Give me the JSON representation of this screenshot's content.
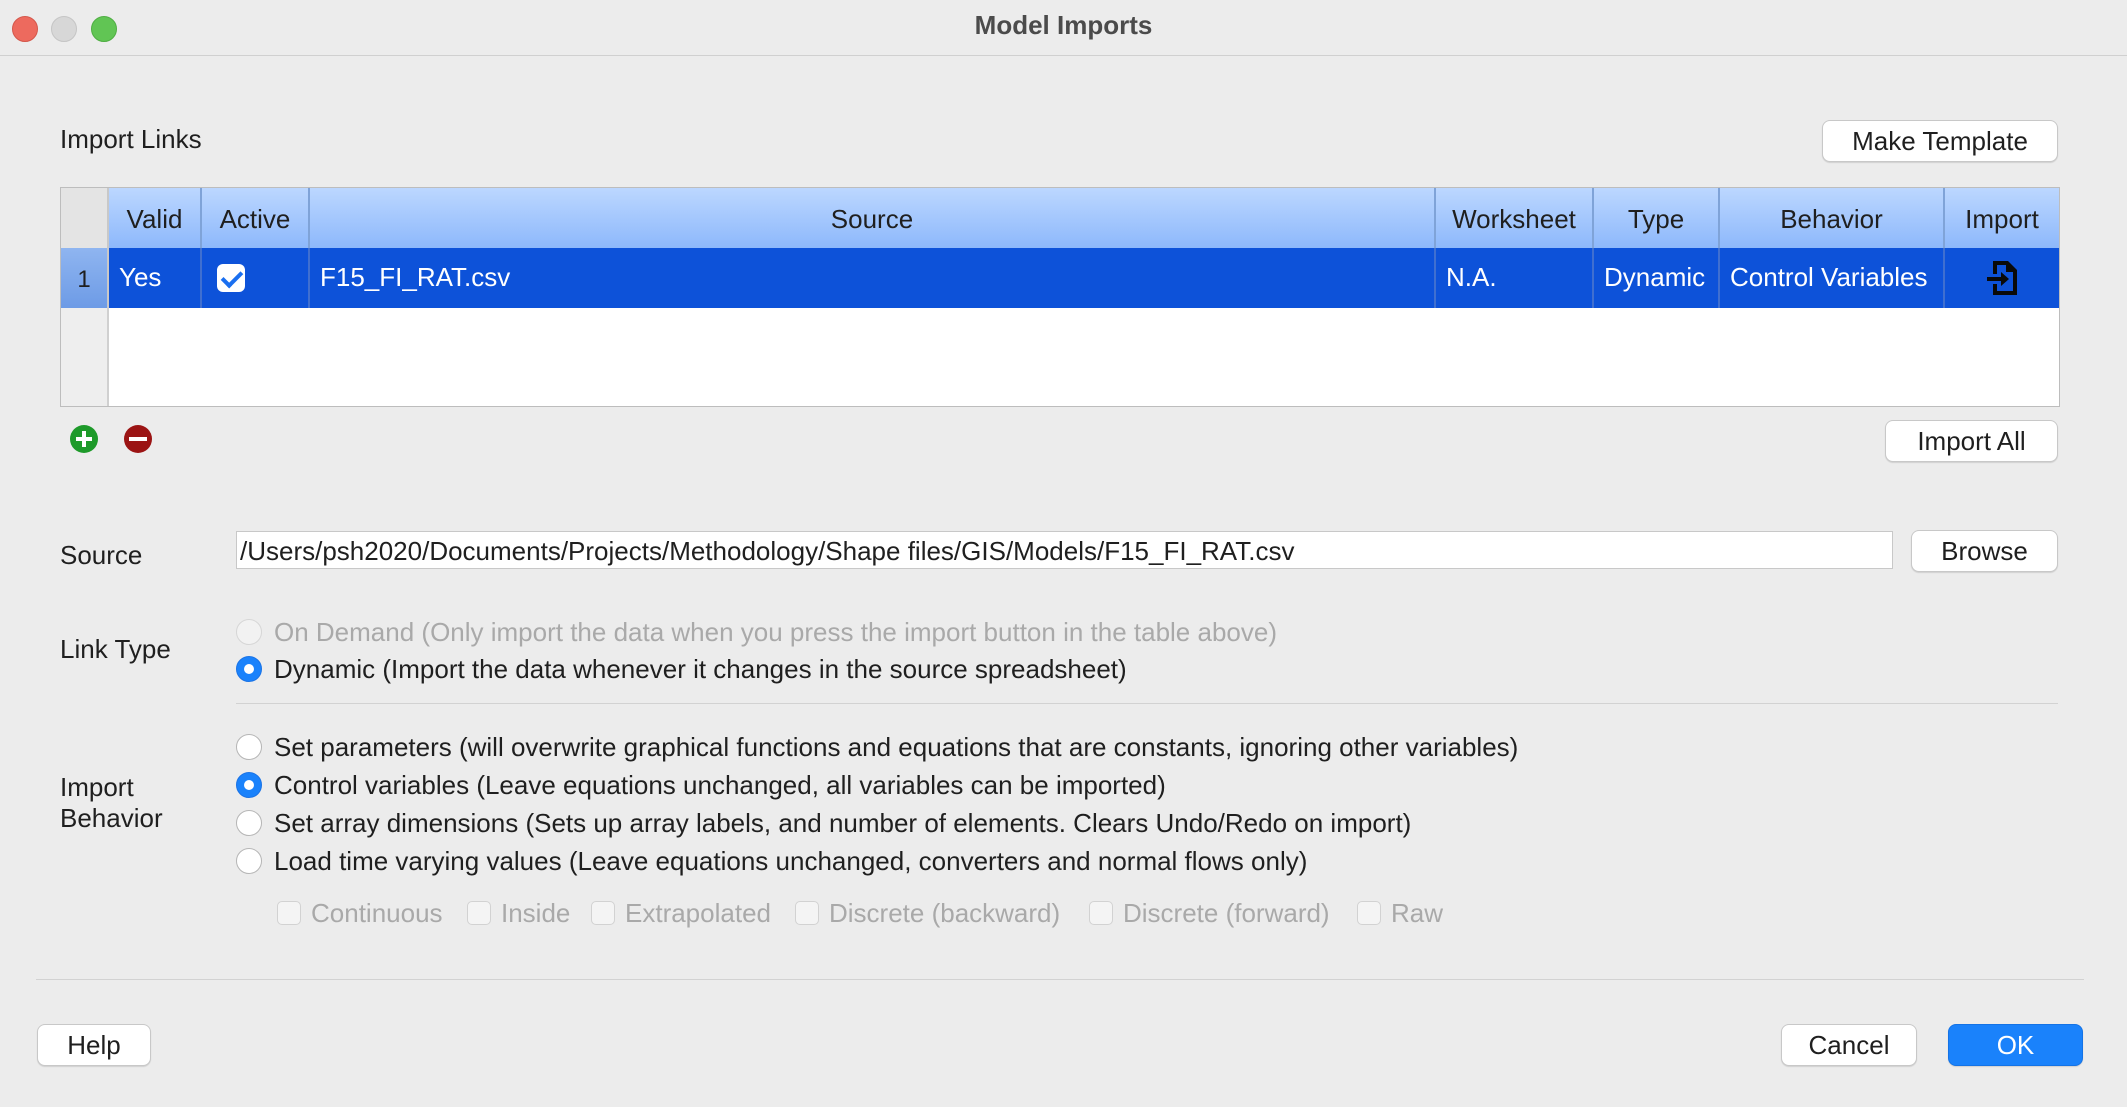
{
  "window": {
    "title": "Model Imports"
  },
  "import_links": {
    "label": "Import Links",
    "make_template_label": "Make Template",
    "import_all_label": "Import All",
    "columns": [
      "Valid",
      "Active",
      "Source",
      "Worksheet",
      "Type",
      "Behavior",
      "Import"
    ],
    "rows": [
      {
        "number": "1",
        "valid": "Yes",
        "active": true,
        "source": "F15_FI_RAT.csv",
        "worksheet": "N.A.",
        "type": "Dynamic",
        "behavior": "Control Variables",
        "import_icon": "import-file-icon"
      }
    ],
    "add_icon": "add-circle-icon",
    "remove_icon": "remove-circle-icon"
  },
  "source": {
    "label": "Source",
    "value": "/Users/psh2020/Documents/Projects/Methodology/Shape files/GIS/Models/F15_FI_RAT.csv",
    "browse_label": "Browse"
  },
  "link_type": {
    "label": "Link Type",
    "options": [
      {
        "label": "On Demand (Only import the data when you press the import button in the table above)",
        "selected": false,
        "enabled": false
      },
      {
        "label": "Dynamic (Import the data whenever it changes in the source spreadsheet)",
        "selected": true,
        "enabled": true
      }
    ]
  },
  "import_behavior": {
    "label_line1": "Import",
    "label_line2": "Behavior",
    "options": [
      {
        "label": "Set parameters (will overwrite graphical functions and equations that are constants, ignoring other variables)",
        "selected": false
      },
      {
        "label": "Control variables (Leave equations unchanged, all variables can be imported)",
        "selected": true
      },
      {
        "label": "Set array dimensions (Sets up array labels, and number of elements. Clears Undo/Redo on import)",
        "selected": false
      },
      {
        "label": "Load time varying values (Leave equations unchanged, converters and normal flows only)",
        "selected": false
      }
    ],
    "interpolation": [
      "Continuous",
      "Inside",
      "Extrapolated",
      "Discrete (backward)",
      "Discrete (forward)",
      "Raw"
    ]
  },
  "footer": {
    "help_label": "Help",
    "cancel_label": "Cancel",
    "ok_label": "OK"
  },
  "colors": {
    "selection": "#0d52d9",
    "accent": "#1a82fb",
    "header": "#a8c9fd"
  }
}
